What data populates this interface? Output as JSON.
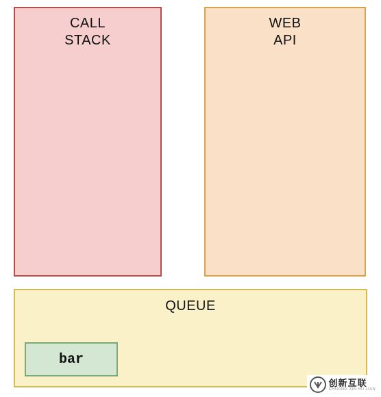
{
  "call_stack": {
    "title_line1": "CALL",
    "title_line2": "STACK"
  },
  "web_api": {
    "title_line1": "WEB",
    "title_line2": "API"
  },
  "queue": {
    "title": "QUEUE",
    "items": [
      {
        "label": "bar"
      }
    ]
  },
  "brand": {
    "main": "创新互联",
    "sub": "CHUANG XIN HU LIAN"
  }
}
